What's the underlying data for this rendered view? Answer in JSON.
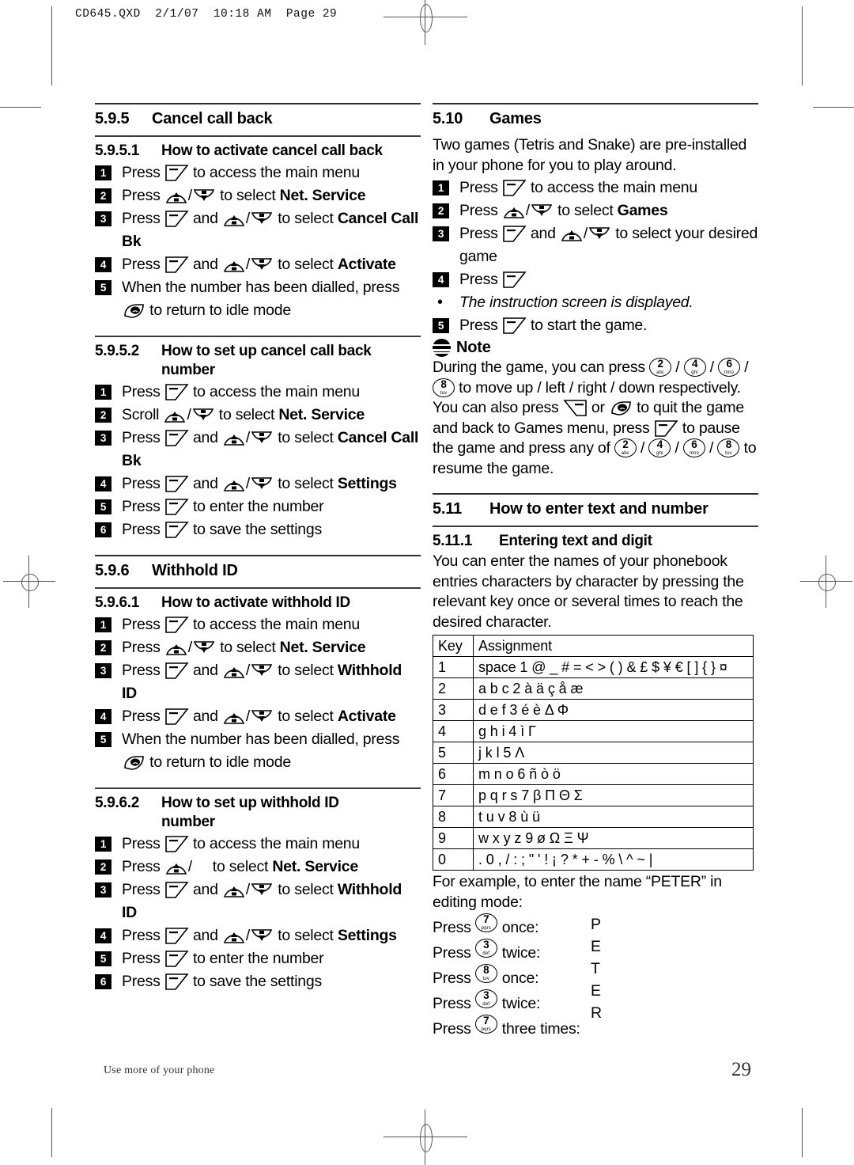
{
  "print_header": "CD645.QXD  2/1/07  10:18 AM  Page 29",
  "footer": {
    "left": "Use more of your phone",
    "page_number": "29"
  },
  "icons": {
    "soft_key": "soft-key-icon",
    "nav_up": "nav-up-key-icon",
    "nav_down": "nav-down-key-icon",
    "exit_key": "exit-key-icon",
    "note": "note-icon"
  },
  "left_column": {
    "section_5_9_5": {
      "number": "5.9.5",
      "title": "Cancel call back",
      "sub1": {
        "number": "5.9.5.1",
        "title": "How to activate cancel call back",
        "steps": [
          {
            "n": "1",
            "pre": "Press",
            "mid": "to access the main menu"
          },
          {
            "n": "2",
            "pre": "Press",
            "mid": "to select",
            "bold": "Net. Service"
          },
          {
            "n": "3",
            "pre": "Press",
            "mid": "and",
            "tail": "to select",
            "bold": "Cancel Call Bk"
          },
          {
            "n": "4",
            "pre": "Press",
            "mid": "and",
            "tail": "to select",
            "bold": "Activate"
          },
          {
            "n": "5",
            "pre": "When the number has been dialled, press",
            "mid": "to return to idle mode"
          }
        ]
      },
      "sub2": {
        "number": "5.9.5.2",
        "title_line1": "How to set up cancel call back",
        "title_line2": "number",
        "steps": [
          {
            "n": "1",
            "pre": "Press",
            "mid": "to access the main menu"
          },
          {
            "n": "2",
            "pre": "Scroll",
            "mid": "to select",
            "bold": "Net. Service"
          },
          {
            "n": "3",
            "pre": "Press",
            "mid": "and",
            "tail": "to select",
            "bold": "Cancel Call Bk"
          },
          {
            "n": "4",
            "pre": "Press",
            "mid": "and",
            "tail": "to select",
            "bold": "Settings"
          },
          {
            "n": "5",
            "pre": "Press",
            "mid": "to enter the number"
          },
          {
            "n": "6",
            "pre": "Press",
            "mid": "to save the settings"
          }
        ]
      }
    },
    "section_5_9_6": {
      "number": "5.9.6",
      "title": "Withhold ID",
      "sub1": {
        "number": "5.9.6.1",
        "title": "How to activate withhold ID",
        "steps": [
          {
            "n": "1",
            "pre": "Press",
            "mid": "to access the main menu"
          },
          {
            "n": "2",
            "pre": "Press",
            "mid": "to select",
            "bold": "Net. Service"
          },
          {
            "n": "3",
            "pre": "Press",
            "mid": "and",
            "tail": "to select",
            "bold": "Withhold ID"
          },
          {
            "n": "4",
            "pre": "Press",
            "mid": "and",
            "tail": "to select",
            "bold": "Activate"
          },
          {
            "n": "5",
            "pre": "When the number has been dialled, press",
            "mid": "to return to idle mode"
          }
        ]
      },
      "sub2": {
        "number": "5.9.6.2",
        "title_line1": "How to set up withhold ID",
        "title_line2": "number",
        "steps": [
          {
            "n": "1",
            "pre": "Press",
            "mid": "to access the main menu"
          },
          {
            "n": "2",
            "pre": "Press",
            "mid": "to select",
            "bold": "Net. Service"
          },
          {
            "n": "3",
            "pre": "Press",
            "mid": "and",
            "tail": "to select",
            "bold": "Withhold ID"
          },
          {
            "n": "4",
            "pre": "Press",
            "mid": "and",
            "tail": "to select",
            "bold": "Settings"
          },
          {
            "n": "5",
            "pre": "Press",
            "mid": "to enter the number"
          },
          {
            "n": "6",
            "pre": "Press",
            "mid": "to save the settings"
          }
        ]
      }
    }
  },
  "right_column": {
    "section_5_10": {
      "number": "5.10",
      "title": "Games",
      "intro": "Two games (Tetris and Snake) are pre-installed in your phone for you to play around.",
      "steps": [
        {
          "n": "1",
          "pre": "Press",
          "mid": "to access the main menu"
        },
        {
          "n": "2",
          "pre": "Press",
          "mid": "to select",
          "bold": "Games"
        },
        {
          "n": "3",
          "pre": "Press",
          "mid": "and",
          "tail": "to select your desired game"
        },
        {
          "n": "4",
          "pre": "Press",
          "mid": ""
        },
        {
          "n": "•",
          "italic": "The instruction screen is displayed."
        },
        {
          "n": "5",
          "pre": "Press",
          "mid": "to start the game."
        }
      ],
      "note": {
        "title": "Note",
        "t1": "During the game, you can press",
        "t2": "to move up / left / right / down respectively. You can also press",
        "t3": "or",
        "t4": "to quit the game and back to Games menu, press",
        "t5": "to pause the game and press any of",
        "t6": "to resume the game."
      }
    },
    "section_5_11": {
      "number": "5.11",
      "title": "How to enter text and number",
      "sub1": {
        "number": "5.11.1",
        "title": "Entering text and digit",
        "intro": "You can enter the names of your phonebook entries characters by character by pressing the relevant key once or several times to reach the desired character."
      },
      "table": {
        "headers": [
          "Key",
          "Assignment"
        ],
        "rows": [
          {
            "key": "1",
            "assignment": "space 1 @ _ # = < > ( ) & £ $ ¥ € [ ] { } ¤"
          },
          {
            "key": "2",
            "assignment": "a b c 2 à ä ç å æ"
          },
          {
            "key": "3",
            "assignment": "d e f 3 é è Δ Φ"
          },
          {
            "key": "4",
            "assignment": "g h i 4 ì Γ"
          },
          {
            "key": "5",
            "assignment": "j k l 5 Λ"
          },
          {
            "key": "6",
            "assignment": "m n o 6 ñ ò ö"
          },
          {
            "key": "7",
            "assignment": "p q r s 7 β Π Θ Σ"
          },
          {
            "key": "8",
            "assignment": "t u v 8 ù ü"
          },
          {
            "key": "9",
            "assignment": "w x y z 9 ø Ω Ξ Ψ"
          },
          {
            "key": "0",
            "assignment": ". 0 , / : ; \" ' ! ¡ ? * + - % \\ ^ ~ |"
          }
        ]
      },
      "example": {
        "intro": "For example, to enter the name “PETER” in editing mode:",
        "rows": [
          {
            "press": "Press",
            "key": "7",
            "sub": "pqrs",
            "times": "once:",
            "result": "P"
          },
          {
            "press": "Press",
            "key": "3",
            "sub": "def",
            "times": "twice:",
            "result": "E"
          },
          {
            "press": "Press",
            "key": "8",
            "sub": "tuv",
            "times": "once:",
            "result": "T"
          },
          {
            "press": "Press",
            "key": "3",
            "sub": "def",
            "times": "twice:",
            "result": "E"
          },
          {
            "press": "Press",
            "key": "7",
            "sub": "pqrs",
            "times": "three times:",
            "result": "R"
          }
        ]
      }
    }
  }
}
